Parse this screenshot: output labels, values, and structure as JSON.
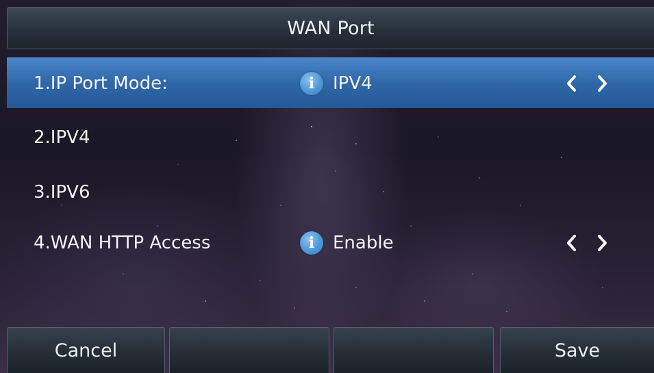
{
  "header": {
    "title": "WAN Port"
  },
  "menu": {
    "items": [
      {
        "label": "1.IP Port Mode:",
        "value": "IPV4",
        "has_info": true,
        "has_arrows": true,
        "selected": true
      },
      {
        "label": "2.IPV4",
        "value": "",
        "has_info": false,
        "has_arrows": false,
        "selected": false
      },
      {
        "label": "3.IPV6",
        "value": "",
        "has_info": false,
        "has_arrows": false,
        "selected": false
      },
      {
        "label": "4.WAN HTTP Access",
        "value": "Enable",
        "has_info": true,
        "has_arrows": true,
        "selected": false
      }
    ]
  },
  "softkeys": {
    "cancel_label": "Cancel",
    "key2_label": "",
    "key3_label": "",
    "save_label": "Save"
  },
  "icons": {
    "info": "info-icon",
    "left": "chevron-left-icon",
    "right": "chevron-right-icon"
  },
  "colors": {
    "selection": "#3067a8",
    "info_icon": "#4e98d8",
    "text": "#f4f4f4"
  }
}
